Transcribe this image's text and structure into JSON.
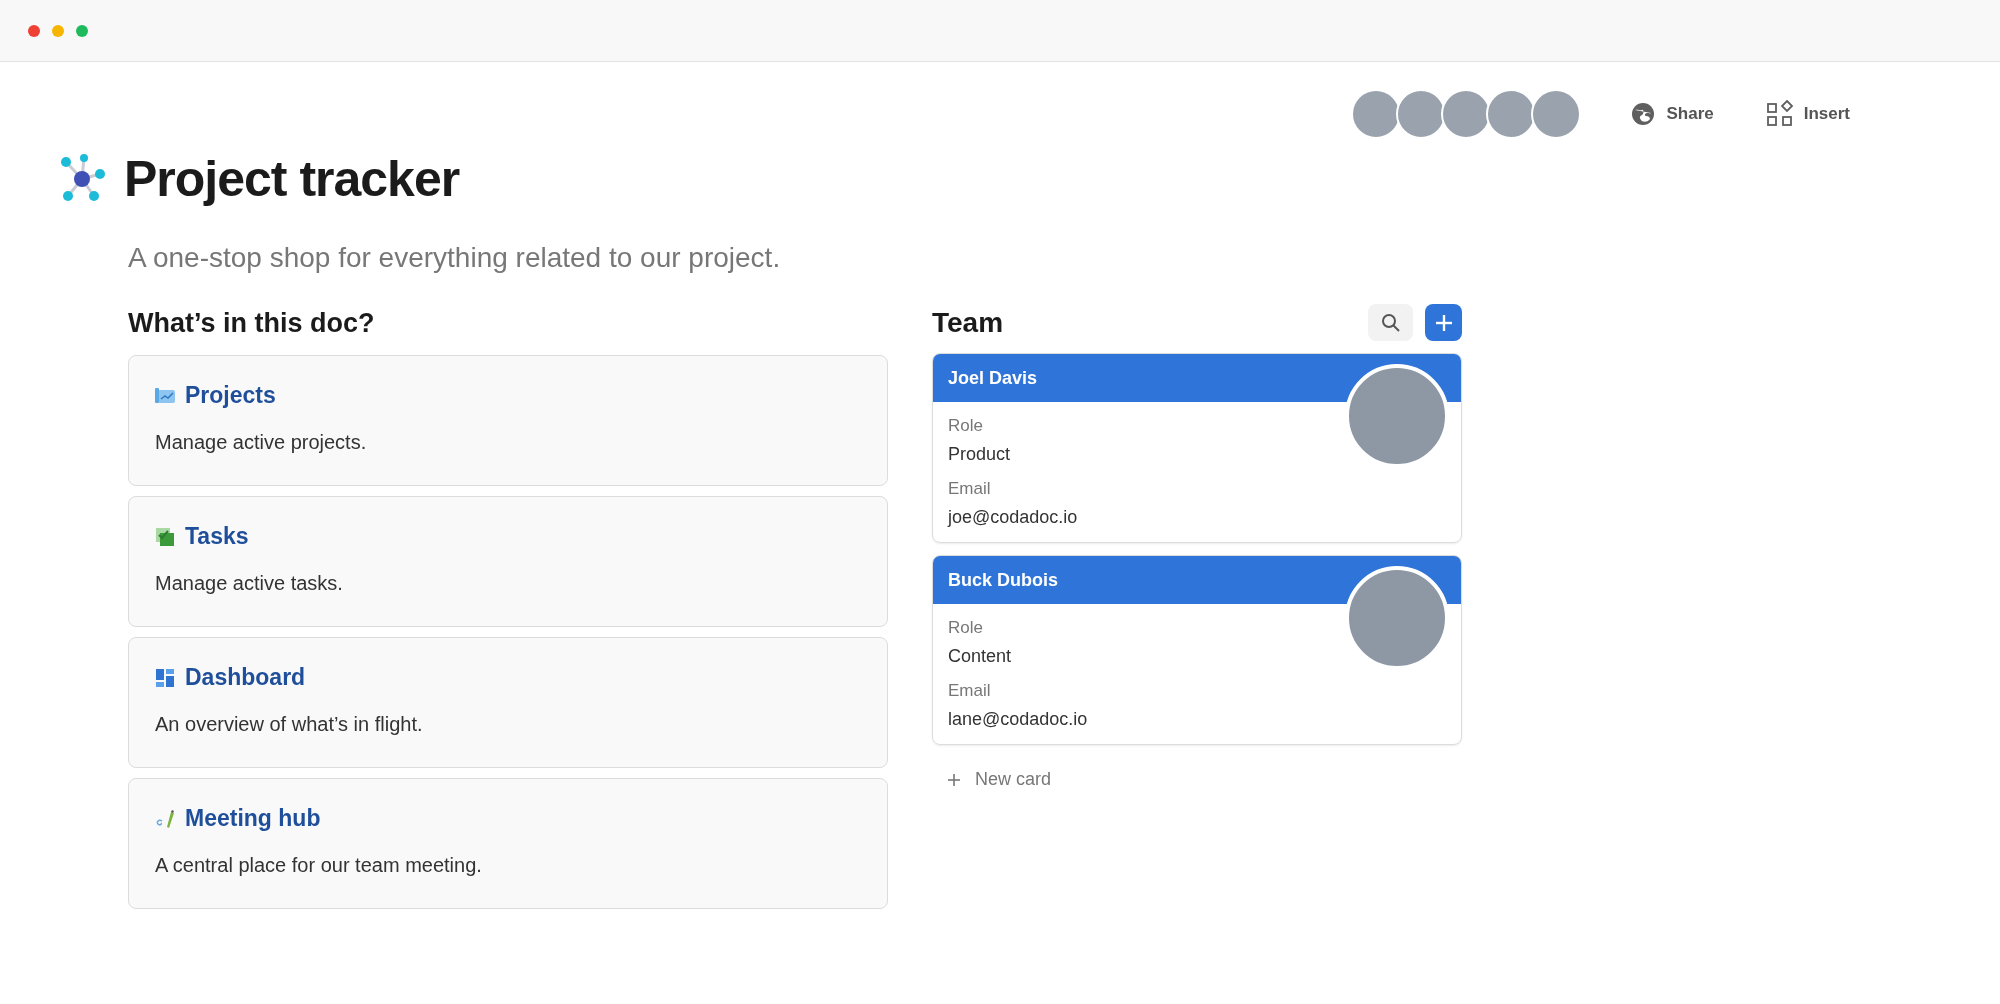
{
  "toolbar": {
    "buttons": [
      {
        "kind": "share",
        "label": "Share"
      },
      {
        "kind": "insert",
        "label": "Insert"
      }
    ]
  },
  "page": {
    "title": "Project tracker",
    "subtitle": "A one-stop shop for everything related to our project."
  },
  "contents": {
    "heading": "What’s in this doc?",
    "cards": [
      {
        "kind": "chart",
        "title": "Projects",
        "description": "Manage active projects."
      },
      {
        "kind": "checklist",
        "title": "Tasks",
        "description": "Manage active tasks."
      },
      {
        "kind": "dashboard",
        "title": "Dashboard",
        "description": "An overview of what’s in flight."
      },
      {
        "kind": "pencil",
        "title": "Meeting hub",
        "description": "A central place for our team meeting."
      }
    ]
  },
  "team": {
    "heading": "Team",
    "cards": [
      {
        "name": "Joel Davis",
        "fields": [
          {
            "label": "Role",
            "value": "Product"
          },
          {
            "label": "Email",
            "value": "joe@codadoc.io"
          }
        ]
      },
      {
        "name": "Buck Dubois",
        "fields": [
          {
            "label": "Role",
            "value": "Content"
          },
          {
            "label": "Email",
            "value": "lane@codadoc.io"
          }
        ]
      }
    ],
    "new_card": "New card"
  }
}
